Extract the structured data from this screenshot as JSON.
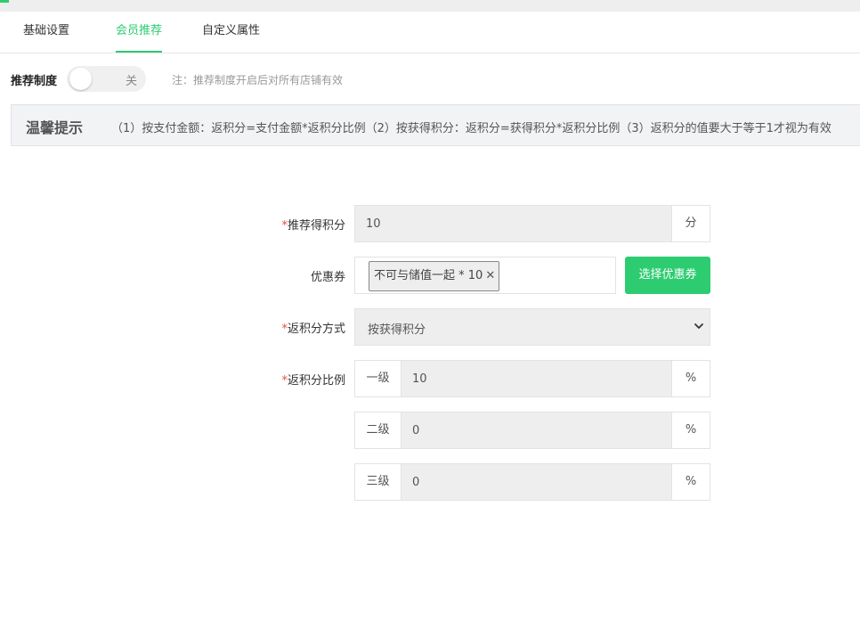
{
  "tabs": [
    {
      "label": "基础设置",
      "active": false
    },
    {
      "label": "会员推荐",
      "active": true
    },
    {
      "label": "自定义属性",
      "active": false
    }
  ],
  "accent_color": "#2ecc71",
  "recommend_switch": {
    "label": "推荐制度",
    "state_text": "关",
    "enabled": false,
    "note": "注：推荐制度开启后对所有店铺有效"
  },
  "tip": {
    "title": "温馨提示",
    "text": "（1）按支付金额：返积分=支付金额*返积分比例（2）按获得积分：返积分=获得积分*返积分比例（3）返积分的值要大于等于1才视为有效"
  },
  "form": {
    "points": {
      "required_mark": "*",
      "label": "推荐得积分",
      "value": "10",
      "unit": "分"
    },
    "coupon": {
      "label": "优惠券",
      "tag": "不可与储值一起 * 10",
      "remove_icon": "close-icon",
      "button": "选择优惠券"
    },
    "method": {
      "required_mark": "*",
      "label": "返积分方式",
      "selected": "按获得积分"
    },
    "ratio": {
      "required_mark": "*",
      "label": "返积分比例",
      "levels": [
        {
          "name": "一级",
          "value": "10",
          "unit": "%"
        },
        {
          "name": "二级",
          "value": "0",
          "unit": "%"
        },
        {
          "name": "三级",
          "value": "0",
          "unit": "%"
        }
      ]
    }
  }
}
